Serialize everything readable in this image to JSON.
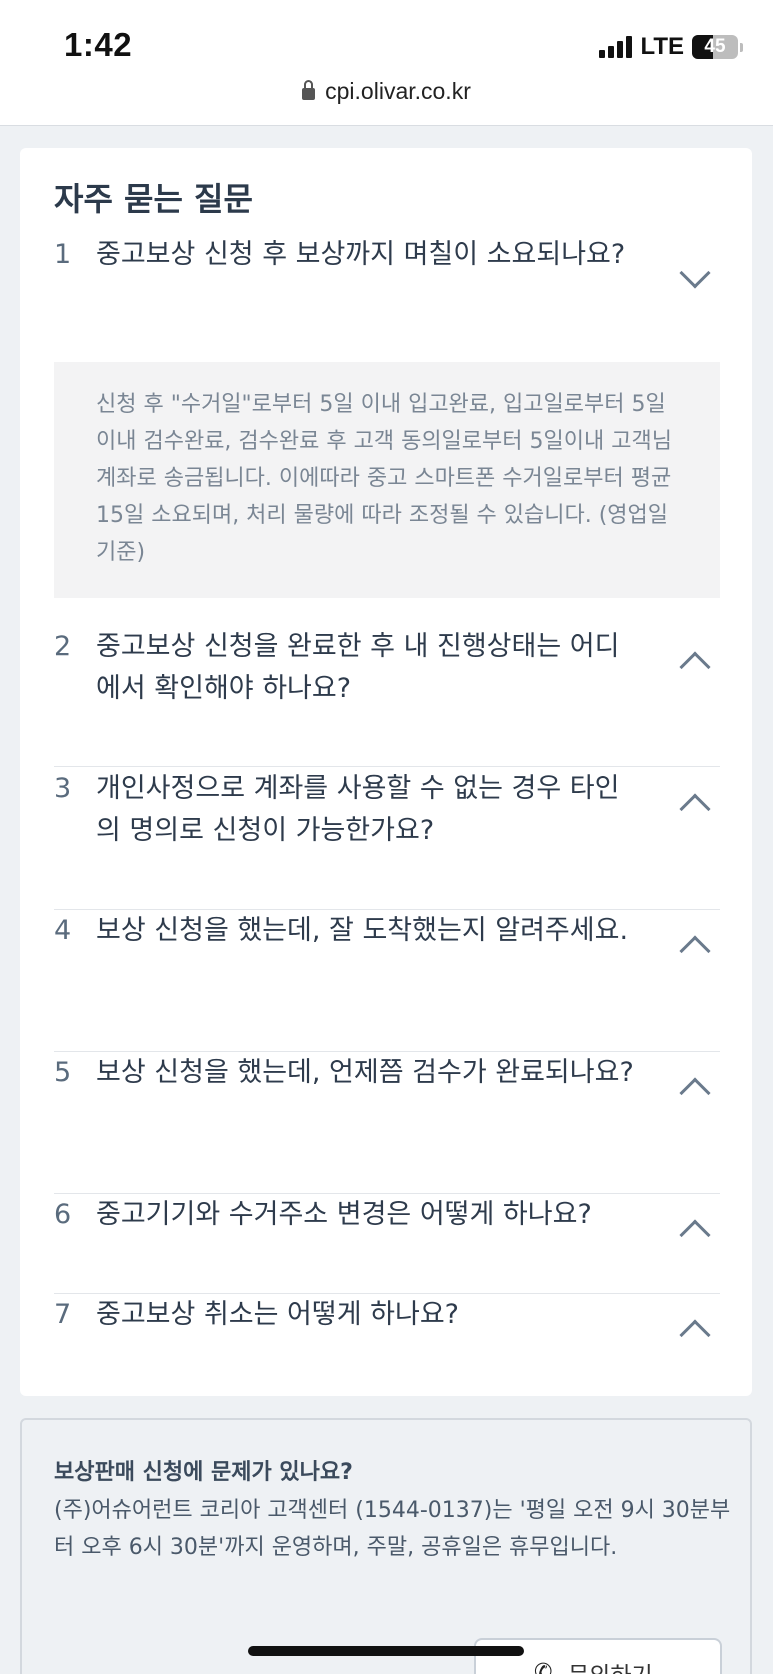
{
  "status_bar": {
    "time": "1:42",
    "network": "LTE",
    "battery": "45",
    "battery_level": 0.45
  },
  "browser": {
    "url": "cpi.olivar.co.kr"
  },
  "faq": {
    "title": "자주 묻는 질문",
    "items": [
      {
        "number": "1",
        "question": "중고보상 신청 후 보상까지 며칠이 소요되나요?",
        "expanded": true,
        "answer": "신청 후 \"수거일\"로부터 5일 이내 입고완료, 입고일로부터 5일이내 검수완료, 검수완료 후 고객 동의일로부터 5일이내 고객님 계좌로 송금됩니다. 이에따라 중고 스마트폰 수거일로부터 평균 15일 소요되며, 처리 물량에 따라 조정될 수 있습니다. (영업일 기준)"
      },
      {
        "number": "2",
        "question": "중고보상 신청을 완료한 후 내 진행상태는 어디에서 확인해야 하나요?",
        "expanded": false
      },
      {
        "number": "3",
        "question": "개인사정으로 계좌를 사용할 수 없는 경우 타인의 명의로 신청이 가능한가요?",
        "expanded": false
      },
      {
        "number": "4",
        "question": "보상 신청을 했는데, 잘 도착했는지 알려주세요.",
        "expanded": false
      },
      {
        "number": "5",
        "question": "보상 신청을 했는데, 언제쯤 검수가 완료되나요?",
        "expanded": false
      },
      {
        "number": "6",
        "question": "중고기기와 수거주소 변경은 어떻게 하나요?",
        "expanded": false
      },
      {
        "number": "7",
        "question": "중고보상 취소는 어떻게 하나요?",
        "expanded": false
      }
    ]
  },
  "help": {
    "title": "보상판매 신청에 문제가 있나요?",
    "body": "(주)어슈어런트 코리아 고객센터 (1544-0137)는 '평일 오전 9시 30분부터 오후 6시 30분'까지 운영하며, 주말, 공휴일은 휴무입니다.",
    "button_label": "문의하기",
    "button_icon": "phone-icon"
  }
}
